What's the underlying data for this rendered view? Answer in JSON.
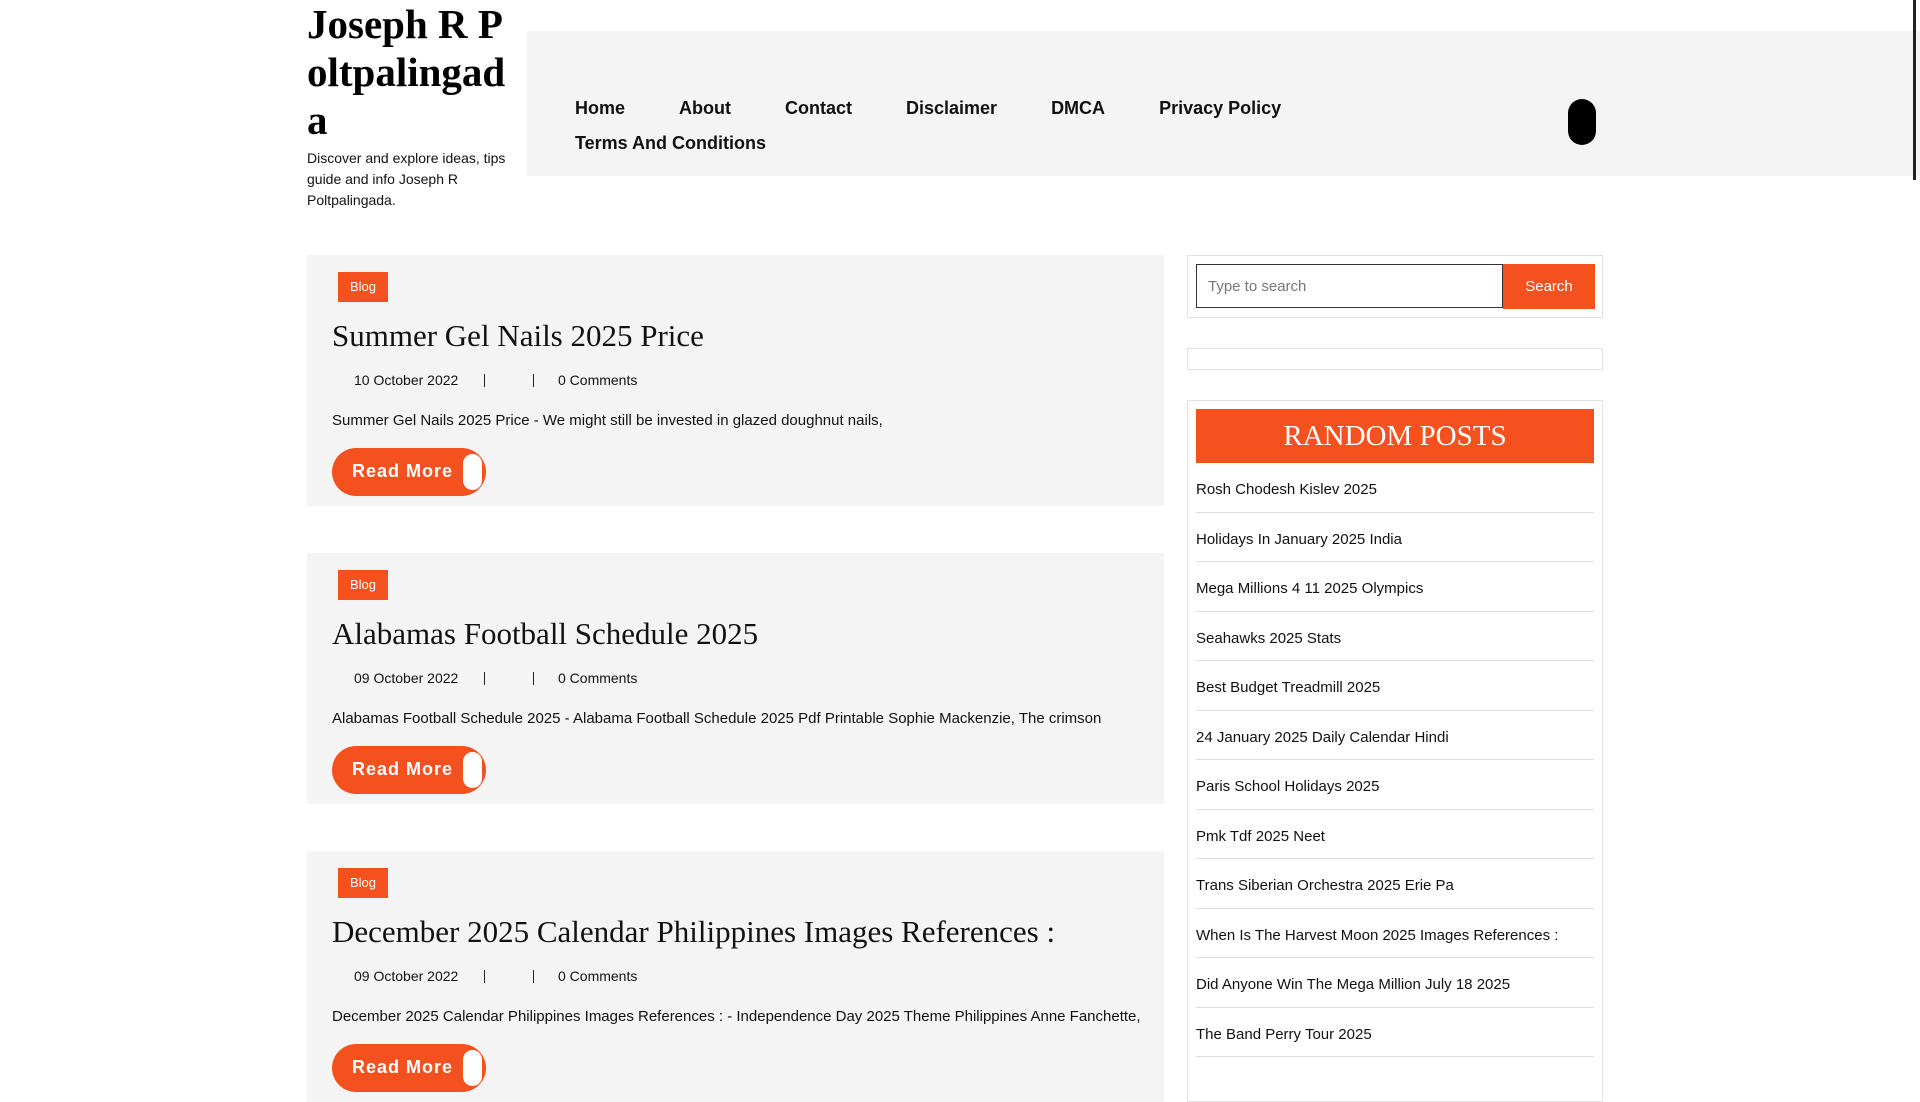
{
  "site": {
    "title": "Joseph R Poltpalingada",
    "description": "Discover and explore ideas, tips guide and info Joseph R Poltpalingada."
  },
  "nav": {
    "items": [
      "Home",
      "About",
      "Contact",
      "Disclaimer",
      "DMCA",
      "Privacy Policy",
      "Terms And Conditions"
    ]
  },
  "posts": [
    {
      "category": "Blog",
      "title": "Summer Gel Nails 2025 Price",
      "date": "10 October 2022",
      "comments": "0 Comments",
      "excerpt": "Summer Gel Nails 2025 Price - We might still be invested in glazed doughnut nails,",
      "read_more": "Read More"
    },
    {
      "category": "Blog",
      "title": "Alabamas Football Schedule 2025",
      "date": "09 October 2022",
      "comments": "0 Comments",
      "excerpt": "Alabamas Football Schedule 2025 - Alabama Football Schedule 2025 Pdf Printable Sophie Mackenzie, The crimson",
      "read_more": "Read More"
    },
    {
      "category": "Blog",
      "title": "December 2025 Calendar Philippines Images References :",
      "date": "09 October 2022",
      "comments": "0 Comments",
      "excerpt": "December 2025 Calendar Philippines Images References : - Independence Day 2025 Theme Philippines Anne Fanchette,",
      "read_more": "Read More"
    }
  ],
  "search": {
    "placeholder": "Type to search",
    "button": "Search"
  },
  "random_posts": {
    "title": "RANDOM POSTS",
    "items": [
      "Rosh Chodesh Kislev 2025",
      "Holidays In January 2025 India",
      "Mega Millions 4 11 2025 Olympics",
      "Seahawks 2025 Stats",
      "Best Budget Treadmill 2025",
      "24 January 2025 Daily Calendar Hindi",
      "Paris School Holidays 2025",
      "Pmk Tdf 2025 Neet",
      "Trans Siberian Orchestra 2025 Erie Pa",
      "When Is The Harvest Moon 2025 Images References :",
      "Did Anyone Win The Mega Million July 18 2025",
      "The Band Perry Tour 2025"
    ]
  },
  "colors": {
    "accent": "#f4511e",
    "panel": "#f4f4f4"
  }
}
